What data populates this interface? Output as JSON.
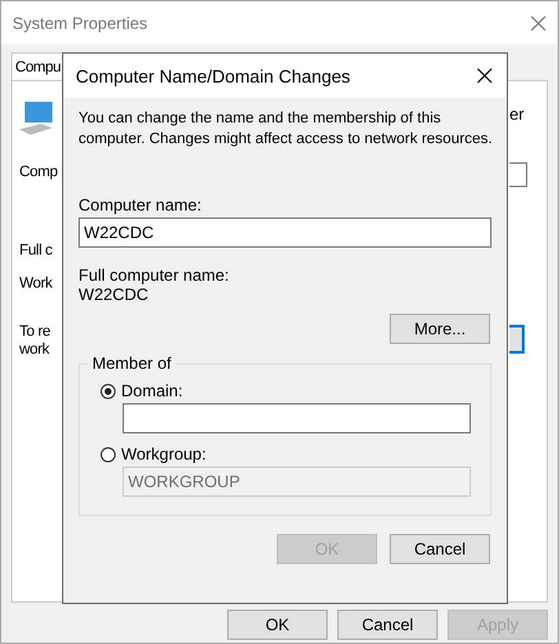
{
  "background_window": {
    "title": "System Properties",
    "tab": "Compu",
    "left_labels": [
      "Comp",
      "Full c",
      "Work",
      "To re",
      "work"
    ],
    "right_label": "er",
    "buttons": [
      {
        "label": "OK",
        "disabled": false
      },
      {
        "label": "Cancel",
        "disabled": false
      },
      {
        "label": "Apply",
        "disabled": true
      }
    ]
  },
  "dialog": {
    "title": "Computer Name/Domain Changes",
    "description": "You can change the name and the membership of this computer. Changes might affect access to network resources.",
    "computer_name_label": "Computer name:",
    "computer_name": "W22CDC",
    "full_name_label": "Full computer name:",
    "full_name": "W22CDC",
    "more_button": "More...",
    "member_of": {
      "title": "Member of",
      "options": [
        {
          "label": "Domain:",
          "selected": true
        },
        {
          "label": "Workgroup:",
          "selected": false,
          "value": "WORKGROUP"
        }
      ]
    },
    "buttons": [
      {
        "label": "OK",
        "disabled": true
      },
      {
        "label": "Cancel",
        "disabled": false
      }
    ]
  }
}
